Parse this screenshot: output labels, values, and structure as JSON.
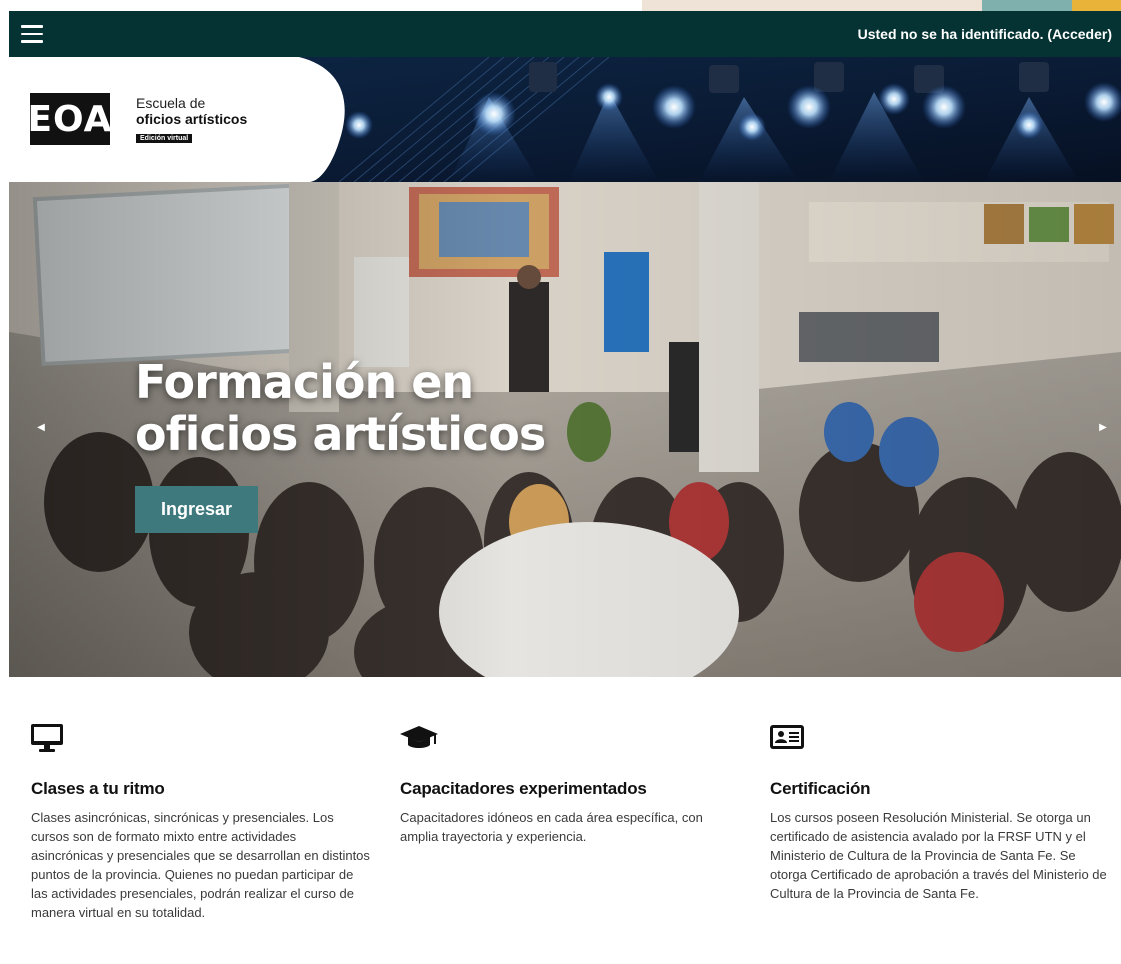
{
  "header": {
    "menu_icon": "hamburger-menu-icon",
    "login_status_text": "Usted no se ha identificado.",
    "login_link": "(Acceder)"
  },
  "banner": {
    "logo_mark": "EOA",
    "logo_line1": "Escuela de",
    "logo_line2": "oficios artísticos",
    "logo_badge": "Edición virtual"
  },
  "hero": {
    "title_line1": "Formación en",
    "title_line2": "oficios artísticos",
    "button_label": "Ingresar",
    "prev_icon": "chevron-left-icon",
    "next_icon": "chevron-right-icon"
  },
  "features": [
    {
      "icon": "desktop-icon",
      "title": "Clases a tu ritmo",
      "text": "Clases asincrónicas, sincrónicas y presenciales. Los cursos son de formato mixto entre actividades asincrónicas y presenciales que se desarrollan en distintos puntos de la provincia. Quienes no puedan participar de las actividades presenciales, podrán realizar el curso de manera virtual en su totalidad."
    },
    {
      "icon": "graduation-cap-icon",
      "title": "Capacitadores experimentados",
      "text": "Capacitadores idóneos en cada área específica, con amplia trayectoria y experiencia."
    },
    {
      "icon": "id-card-icon",
      "title": "Certificación",
      "text": "Los cursos poseen Resolución Ministerial. Se otorga un certificado de asistencia avalado por la FRSF UTN y el Ministerio de Cultura de la Provincia de Santa Fe. Se otorga Certificado de aprobación a través del Ministerio de Cultura de la Provincia de Santa Fe."
    }
  ],
  "colors": {
    "navbar": "#053333",
    "button": "#3e7a7d",
    "banner_dark": "#0b1b2f"
  }
}
